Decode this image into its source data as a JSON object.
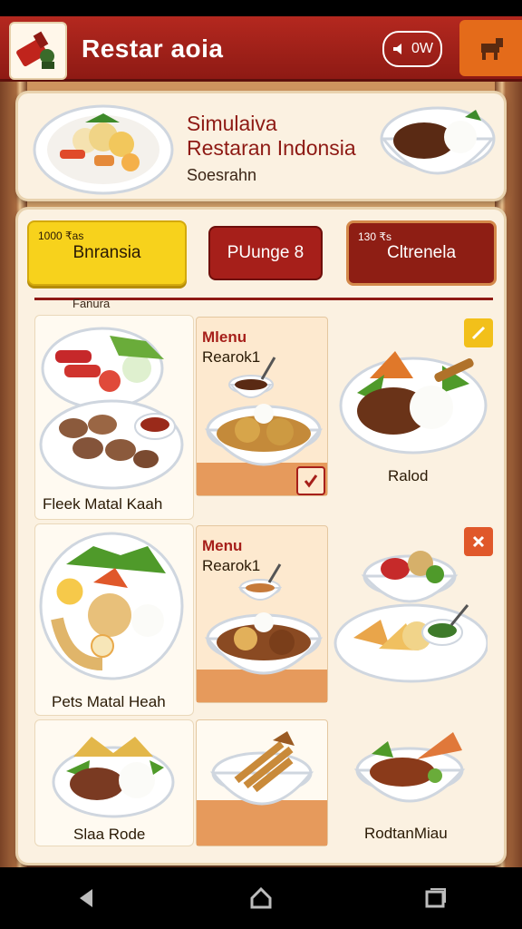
{
  "header": {
    "title": "Restar aoia",
    "volume_label": "0W",
    "logo_icon": "chef-hat-icon",
    "category_icon": "animal-icon"
  },
  "hero": {
    "title_line1": "Simulaiva",
    "title_line2": "Restaran Indonsia",
    "subtitle": "Soesrahn"
  },
  "tabs": [
    {
      "tag": "1000 ₹as",
      "label": "Bnransia"
    },
    {
      "tag": "",
      "label": "PUunge 8"
    },
    {
      "tag": "130 ₹s",
      "label": "Cltrenela"
    }
  ],
  "divider_label": "Fanura",
  "row1": {
    "left_label": "Fleek Matal Kaah",
    "menu_title": "Mlenu",
    "menu_sub": "Rearok1",
    "right_label": "Ralod"
  },
  "row2": {
    "left_label": "Pets Matal Heah",
    "menu_title": "Menu",
    "menu_sub": "Rearok1"
  },
  "row3": {
    "left_label": "Slaa Rode",
    "right_label": "RodtanMiau"
  },
  "colors": {
    "header_red": "#a61f1a",
    "accent_orange": "#e46b1a",
    "tab_yellow": "#f7d21c",
    "panel_cream": "#fbf1e1"
  }
}
